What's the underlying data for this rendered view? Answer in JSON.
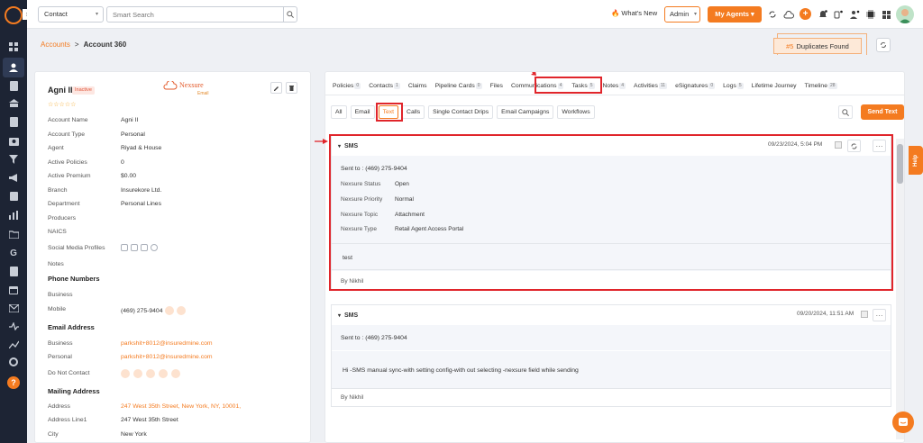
{
  "topbar": {
    "contact_select": "Contact",
    "search_placeholder": "Smart Search",
    "whats_new": "What's New",
    "admin_select": "Admin",
    "my_agents": "My Agents"
  },
  "breadcrumb": {
    "accounts": "Accounts",
    "separator": ">",
    "current": "Account 360"
  },
  "duplicates": {
    "count": "#5",
    "label": "Duplicates Found"
  },
  "account": {
    "name": "Agni II",
    "status": "Inactive",
    "stars": "☆☆☆☆☆",
    "logo_text": "Nexsure",
    "logo_sub": "Email",
    "fields": [
      {
        "label": "Account Name",
        "value": "Agni II"
      },
      {
        "label": "Account Type",
        "value": "Personal"
      },
      {
        "label": "Agent",
        "value": "Riyad & House"
      },
      {
        "label": "Active Policies",
        "value": "0"
      },
      {
        "label": "Active Premium",
        "value": "$0.00"
      },
      {
        "label": "Branch",
        "value": "Insurekore Ltd."
      },
      {
        "label": "Department",
        "value": "Personal Lines"
      },
      {
        "label": "Producers",
        "value": ""
      },
      {
        "label": "NAICS",
        "value": ""
      },
      {
        "label": "Social Media Profiles",
        "value": ""
      },
      {
        "label": "Notes",
        "value": ""
      }
    ],
    "phone_section": "Phone Numbers",
    "phone": [
      {
        "label": "Business",
        "value": ""
      },
      {
        "label": "Mobile",
        "value": "(469) 275-9404"
      }
    ],
    "email_section": "Email Address",
    "email": [
      {
        "label": "Business",
        "value": "parkshit+8012@insuredmine.com"
      },
      {
        "label": "Personal",
        "value": "parkshit+8012@insuredmine.com"
      }
    ],
    "dnc_label": "Do Not Contact",
    "mailing_section": "Mailing Address",
    "mailing": [
      {
        "label": "Address",
        "value": "247 West 35th Street, New York, NY, 10001,"
      },
      {
        "label": "Address Line1",
        "value": "247 West 35th Street"
      },
      {
        "label": "City",
        "value": "New York"
      }
    ]
  },
  "tabs": [
    {
      "label": "Policies",
      "count": "0"
    },
    {
      "label": "Contacts",
      "count": "1"
    },
    {
      "label": "Claims",
      "count": ""
    },
    {
      "label": "Pipeline Cards",
      "count": "0"
    },
    {
      "label": "Files",
      "count": ""
    },
    {
      "label": "Communications",
      "count": "4"
    },
    {
      "label": "Tasks",
      "count": "5"
    },
    {
      "label": "Notes",
      "count": "4"
    },
    {
      "label": "Activities",
      "count": "11"
    },
    {
      "label": "eSignatures",
      "count": "0"
    },
    {
      "label": "Logs",
      "count": "5"
    },
    {
      "label": "Lifetime Journey",
      "count": ""
    },
    {
      "label": "Timeline",
      "count": "28"
    }
  ],
  "subtabs": [
    "All",
    "Email",
    "Text",
    "Calls",
    "Single Contact Drips",
    "Email Campaigns",
    "Workflows"
  ],
  "send_text": "Send Text",
  "messages": [
    {
      "type": "SMS",
      "date": "09/23/2024, 5:04 PM",
      "sent_to": "Sent to : (469) 275-9404",
      "details": [
        {
          "label": "Nexsure Status",
          "value": "Open"
        },
        {
          "label": "Nexsure Priority",
          "value": "Normal"
        },
        {
          "label": "Nexsure Topic",
          "value": "Attachment"
        },
        {
          "label": "Nexsure Type",
          "value": "Retail Agent Access Portal"
        }
      ],
      "body": "test",
      "by": "By Nikhil"
    },
    {
      "type": "SMS",
      "date": "09/20/2024, 11:51 AM",
      "sent_to": "Sent to : (469) 275-9404",
      "body": "Hi -SMS manual sync-with setting config-with out selecting -nexsure field while sending",
      "by": "By Nikhil"
    }
  ],
  "help_tab": "Help",
  "colors": {
    "accent": "#f47b20",
    "highlight": "#e0252b",
    "nav": "#1d2434"
  }
}
